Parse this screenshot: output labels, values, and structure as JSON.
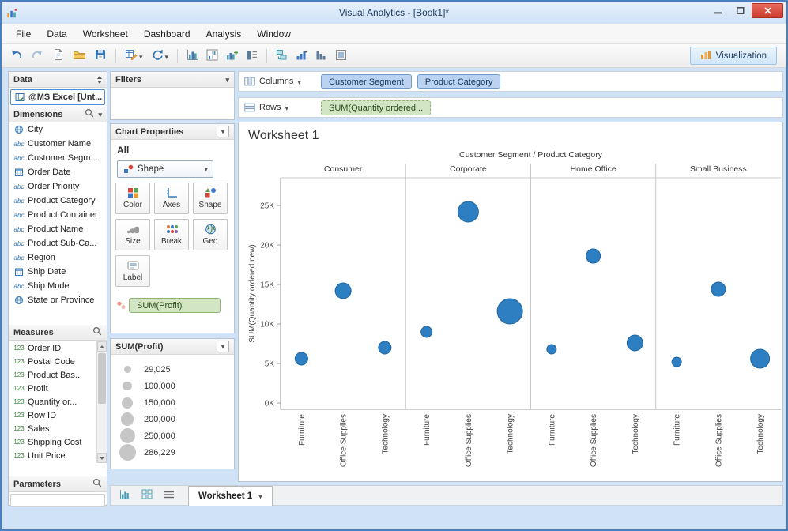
{
  "window": {
    "title": "Visual Analytics - [Book1]*"
  },
  "menu": {
    "items": [
      "File",
      "Data",
      "Worksheet",
      "Dashboard",
      "Analysis",
      "Window"
    ]
  },
  "toolbar": {
    "visualization": "Visualization"
  },
  "data_panel": {
    "header": "Data",
    "connection": "@MS Excel [Unt...",
    "dimensions": {
      "header": "Dimensions",
      "items": [
        {
          "label": "City",
          "icon": "globe"
        },
        {
          "label": "Customer Name",
          "icon": "abc"
        },
        {
          "label": "Customer Segm...",
          "icon": "abc"
        },
        {
          "label": "Order Date",
          "icon": "calendar"
        },
        {
          "label": "Order Priority",
          "icon": "abc"
        },
        {
          "label": "Product Category",
          "icon": "abc"
        },
        {
          "label": "Product Container",
          "icon": "abc"
        },
        {
          "label": "Product Name",
          "icon": "abc"
        },
        {
          "label": "Product Sub-Ca...",
          "icon": "abc"
        },
        {
          "label": "Region",
          "icon": "abc"
        },
        {
          "label": "Ship Date",
          "icon": "calendar"
        },
        {
          "label": "Ship Mode",
          "icon": "abc"
        },
        {
          "label": "State or Province",
          "icon": "globe"
        }
      ]
    },
    "measures": {
      "header": "Measures",
      "items": [
        "Order ID",
        "Postal Code",
        "Product Bas...",
        "Profit",
        "Quantity or...",
        "Row ID",
        "Sales",
        "Shipping Cost",
        "Unit Price"
      ]
    },
    "parameters": {
      "header": "Parameters"
    }
  },
  "cards": {
    "filters": {
      "header": "Filters"
    },
    "chart_properties": {
      "header": "Chart Properties",
      "subheader": "All",
      "mark_type": "Shape",
      "buttons": [
        "Color",
        "Axes",
        "Shape",
        "Size",
        "Break",
        "Geo",
        "Label"
      ],
      "pill": "SUM(Profit)"
    },
    "size_legend": {
      "header": "SUM(Profit)",
      "entries": [
        "29,025",
        "100,000",
        "150,000",
        "200,000",
        "250,000",
        "286,229"
      ]
    }
  },
  "shelves": {
    "columns_label": "Columns",
    "rows_label": "Rows",
    "columns_pills": [
      "Customer Segment",
      "Product Category"
    ],
    "rows_pills": [
      "SUM(Quantity ordered..."
    ]
  },
  "worksheet": {
    "title": "Worksheet 1"
  },
  "tabs": {
    "active": "Worksheet 1"
  },
  "icons": {
    "abc": "abc",
    "numeric": "123"
  },
  "colors": {
    "dimension_pill": "#b9d3f1",
    "measure_pill": "#d3e6c3",
    "mark": "#2e7fc2",
    "legend_circle": "#c6c6c6",
    "close_button": "#c93d2c"
  },
  "chart_data": {
    "type": "scatter",
    "title": "Customer Segment / Product Category",
    "ylabel": "SUM(Quantity ordered new)",
    "yticks": [
      0,
      5,
      10,
      15,
      20,
      25
    ],
    "ytick_labels": [
      "0K",
      "5K",
      "10K",
      "15K",
      "20K",
      "25K"
    ],
    "ylim": [
      -800,
      28500
    ],
    "grid": false,
    "panes": [
      "Consumer",
      "Corporate",
      "Home Office",
      "Small Business"
    ],
    "categories": [
      "Furniture",
      "Office Supplies",
      "Technology"
    ],
    "series": [
      {
        "pane": "Consumer",
        "values": [
          5600,
          14200,
          7000
        ],
        "bubble_radius_px": [
          8,
          10,
          8
        ]
      },
      {
        "pane": "Corporate",
        "values": [
          9000,
          24200,
          11600
        ],
        "bubble_radius_px": [
          7,
          13,
          16
        ]
      },
      {
        "pane": "Home Office",
        "values": [
          6800,
          18600,
          7600
        ],
        "bubble_radius_px": [
          6,
          9,
          10
        ]
      },
      {
        "pane": "Small Business",
        "values": [
          5200,
          14400,
          5600
        ],
        "bubble_radius_px": [
          6,
          9,
          12
        ]
      }
    ],
    "mark_color": "#2e7fc2",
    "mark_stroke": "#2166a0",
    "size_legend_title": "SUM(Profit)"
  }
}
